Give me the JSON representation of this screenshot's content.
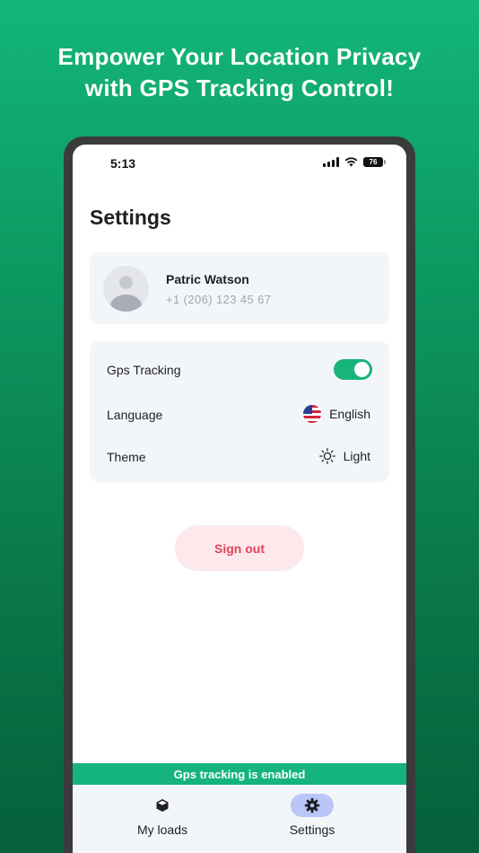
{
  "headline": {
    "line1": "Empower Your Location Privacy",
    "line2": "with GPS Tracking Control!"
  },
  "status_bar": {
    "time": "5:13",
    "battery": "76"
  },
  "page": {
    "title": "Settings"
  },
  "profile": {
    "name": "Patric Watson",
    "phone": "+1 (206) 123 45 67"
  },
  "settings": {
    "gps_label": "Gps Tracking",
    "gps_enabled": true,
    "language_label": "Language",
    "language_value": "English",
    "language_icon": "us-flag-icon",
    "theme_label": "Theme",
    "theme_value": "Light",
    "theme_icon": "sun-icon"
  },
  "signout": {
    "label": "Sign out"
  },
  "gps_banner": {
    "text": "Gps tracking is enabled"
  },
  "nav": {
    "items": [
      {
        "label": "My loads",
        "icon": "box-icon",
        "active": false
      },
      {
        "label": "Settings",
        "icon": "gear-icon",
        "active": true
      }
    ]
  },
  "colors": {
    "accent": "#14b47c",
    "signout_text": "#e3425c",
    "signout_bg": "#fde9ec",
    "nav_active_bg": "#b9c6f7"
  }
}
